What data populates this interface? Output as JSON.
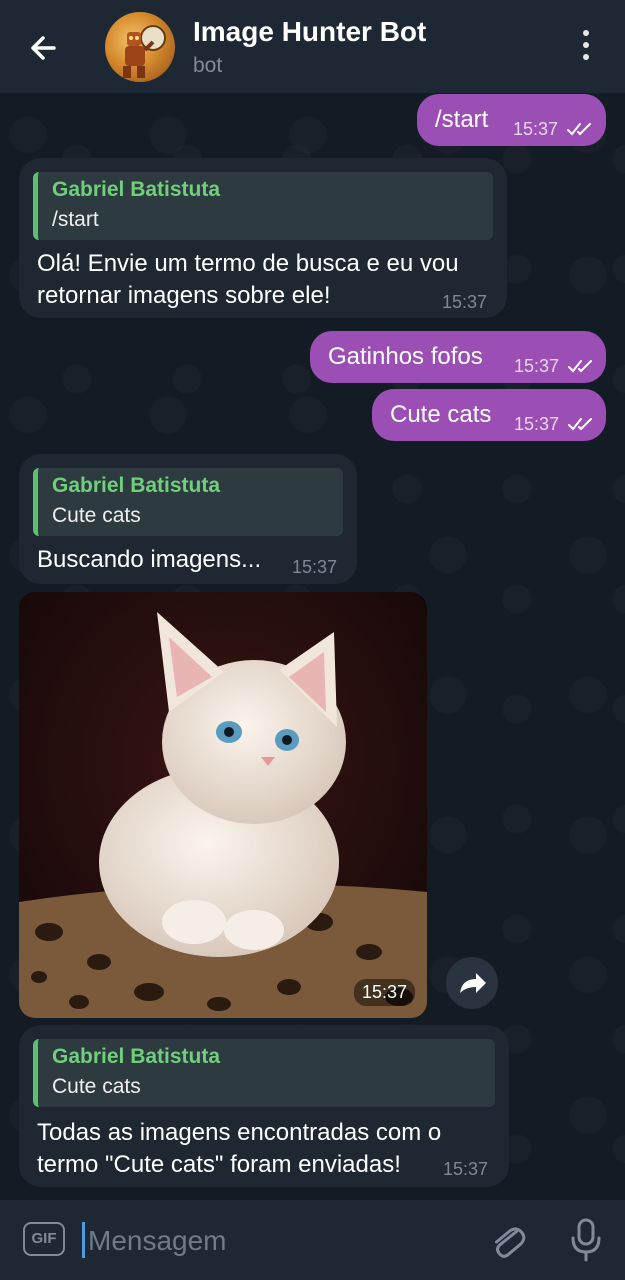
{
  "header": {
    "title": "Image Hunter Bot",
    "subtitle": "bot",
    "avatar_icon": "robot-hunter-avatar",
    "back_icon": "arrow-left-icon",
    "menu_icon": "more-vertical-icon"
  },
  "messages": [
    {
      "direction": "out",
      "text": "/start",
      "time": "15:37",
      "status": "read"
    },
    {
      "direction": "in",
      "reply": {
        "name": "Gabriel Batistuta",
        "text": "/start"
      },
      "lines": [
        "Olá! Envie um termo de busca e eu vou",
        "retornar imagens sobre ele!"
      ],
      "time": "15:37"
    },
    {
      "direction": "out",
      "text": "Gatinhos fofos",
      "time": "15:37",
      "status": "read"
    },
    {
      "direction": "out",
      "text": "Cute cats",
      "time": "15:37",
      "status": "read"
    },
    {
      "direction": "in",
      "reply": {
        "name": "Gabriel Batistuta",
        "text": "Cute cats"
      },
      "lines": [
        "Buscando imagens..."
      ],
      "time": "15:37"
    },
    {
      "direction": "in",
      "type": "photo",
      "alt": "white kitten on leopard-print bed",
      "time": "15:37"
    },
    {
      "direction": "in",
      "reply": {
        "name": "Gabriel Batistuta",
        "text": "Cute cats"
      },
      "lines": [
        "Todas as imagens encontradas com o",
        "termo \"Cute cats\" foram enviadas!"
      ],
      "time": "15:37"
    }
  ],
  "input": {
    "placeholder": "Mensagem",
    "value": "",
    "gif_label": "GIF",
    "attach_icon": "paperclip-icon",
    "mic_icon": "microphone-icon"
  },
  "colors": {
    "header_bg": "#1e2834",
    "chat_bg": "#131b24",
    "outgoing_bubble": "#9b4fb5",
    "incoming_bubble": "#1e2732",
    "reply_accent": "#5cc06e"
  }
}
